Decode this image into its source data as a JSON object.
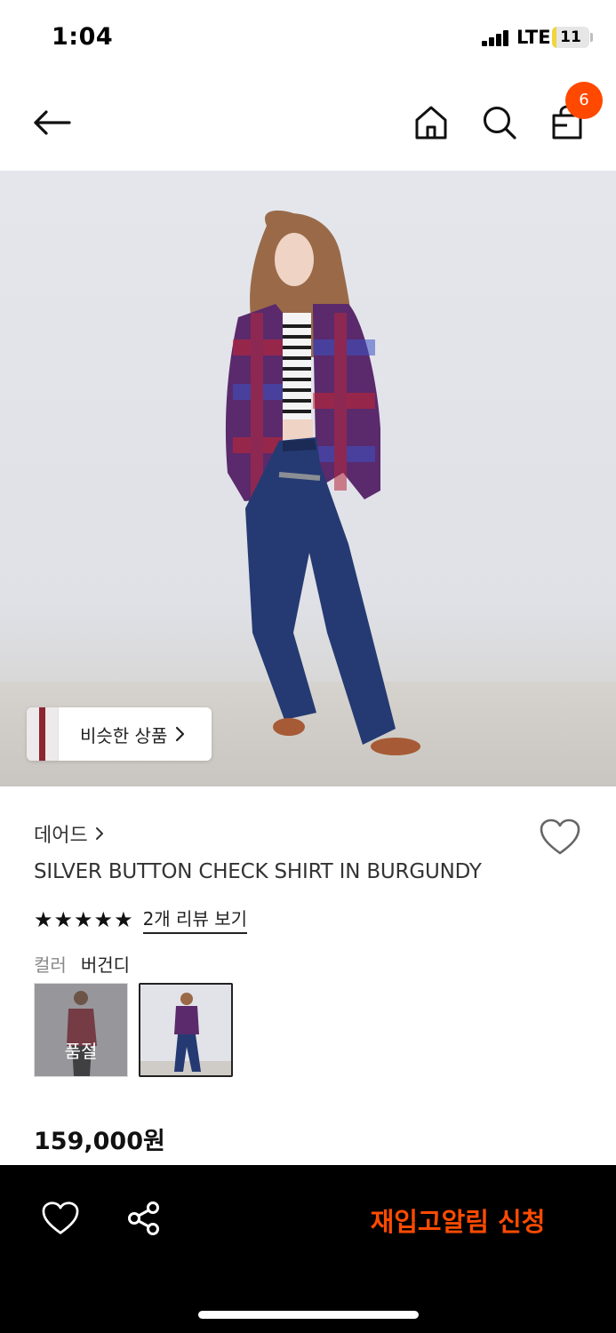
{
  "status_bar": {
    "time": "1:04",
    "network": "LTE",
    "battery": "11",
    "battery_level": 0.11
  },
  "nav": {
    "back_icon": "arrow-left-icon",
    "home_icon": "home-icon",
    "search_icon": "search-icon",
    "cart_icon": "shopping-bag-icon",
    "cart_count": "6",
    "badge_color": "#ff4800"
  },
  "product_image": {
    "similar_label": "비슷한 상품"
  },
  "product": {
    "brand": "데어드",
    "name": "SILVER BUTTON CHECK SHIRT IN BURGUNDY",
    "rating_stars": 5,
    "review_link": "2개 리뷰 보기",
    "color_label": "컬러",
    "color_value": "버건디",
    "swatches": [
      {
        "soldout_label": "품절"
      },
      {
        "soldout_label": ""
      }
    ],
    "price": "159,000원"
  },
  "bottom_bar": {
    "heart_icon": "heart-icon",
    "share_icon": "share-icon",
    "restock_label": "재입고알림 신청",
    "accent_color": "#ff4b00"
  }
}
